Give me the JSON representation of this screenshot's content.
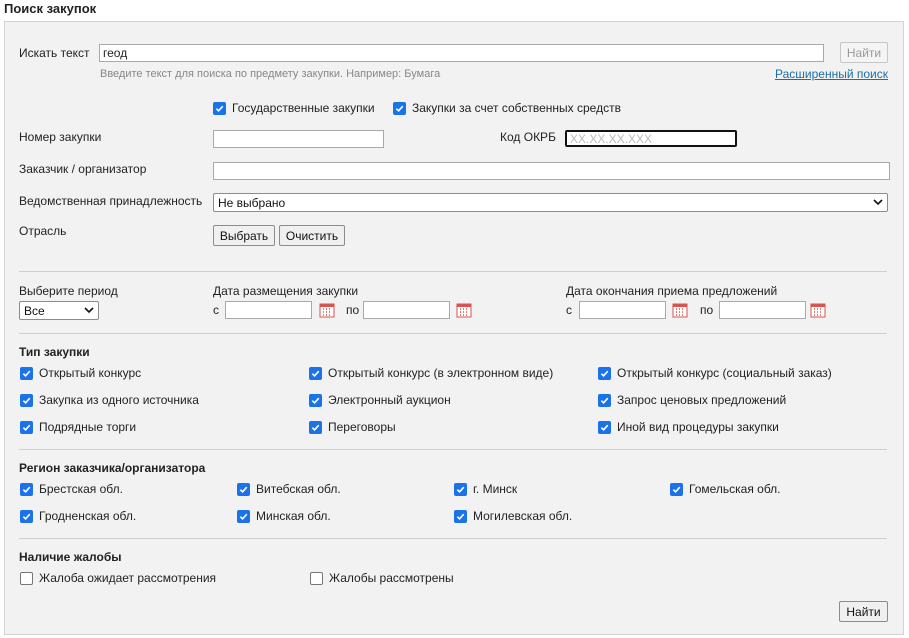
{
  "page": {
    "title": "Поиск закупок"
  },
  "search": {
    "label": "Искать текст",
    "value": "геод",
    "hint": "Введите текст для поиска по предмету закупки. Например: Бумага",
    "find_button": "Найти",
    "advanced_link": "Расширенный поиск"
  },
  "funding": [
    {
      "label": "Государственные закупки",
      "checked": true
    },
    {
      "label": "Закупки за счет собственных средств",
      "checked": true
    }
  ],
  "fields": {
    "number_label": "Номер закупки",
    "number_value": "",
    "okrb_label": "Код ОКРБ",
    "okrb_placeholder": "XX.XX.XX.XXX",
    "customer_label": "Заказчик / организатор",
    "customer_value": "",
    "department_label": "Ведомственная принадлежность",
    "department_value": "Не выбрано",
    "industry_label": "Отрасль",
    "choose_button": "Выбрать",
    "clear_button": "Очистить"
  },
  "period": {
    "label": "Выберите период",
    "value": "Все",
    "placement_label": "Дата размещения закупки",
    "deadline_label": "Дата окончания приема предложений",
    "from": "с",
    "to": "по"
  },
  "procurement_type": {
    "title": "Тип закупки",
    "items": [
      {
        "label": "Открытый конкурс",
        "checked": true
      },
      {
        "label": "Открытый конкурс (в электронном виде)",
        "checked": true
      },
      {
        "label": "Открытый конкурс (социальный заказ)",
        "checked": true
      },
      {
        "label": "Закупка из одного источника",
        "checked": true
      },
      {
        "label": "Электронный аукцион",
        "checked": true
      },
      {
        "label": "Запрос ценовых предложений",
        "checked": true
      },
      {
        "label": "Подрядные торги",
        "checked": true
      },
      {
        "label": "Переговоры",
        "checked": true
      },
      {
        "label": "Иной вид процедуры закупки",
        "checked": true
      }
    ]
  },
  "region": {
    "title": "Регион заказчика/организатора",
    "items": [
      {
        "label": "Брестская обл.",
        "checked": true
      },
      {
        "label": "Витебская обл.",
        "checked": true
      },
      {
        "label": "г. Минск",
        "checked": true
      },
      {
        "label": "Гомельская обл.",
        "checked": true
      },
      {
        "label": "Гродненская обл.",
        "checked": true
      },
      {
        "label": "Минская обл.",
        "checked": true
      },
      {
        "label": "Могилевская обл.",
        "checked": true
      }
    ]
  },
  "complaints": {
    "title": "Наличие жалобы",
    "items": [
      {
        "label": "Жалоба ожидает рассмотрения",
        "checked": false
      },
      {
        "label": "Жалобы рассмотрены",
        "checked": false
      }
    ]
  },
  "footer": {
    "find_button": "Найти"
  },
  "colors": {
    "accent": "#1a73e8",
    "link": "#1a6fa8",
    "panel_bg": "#f2f2f2",
    "calendar": "#d9534f"
  }
}
